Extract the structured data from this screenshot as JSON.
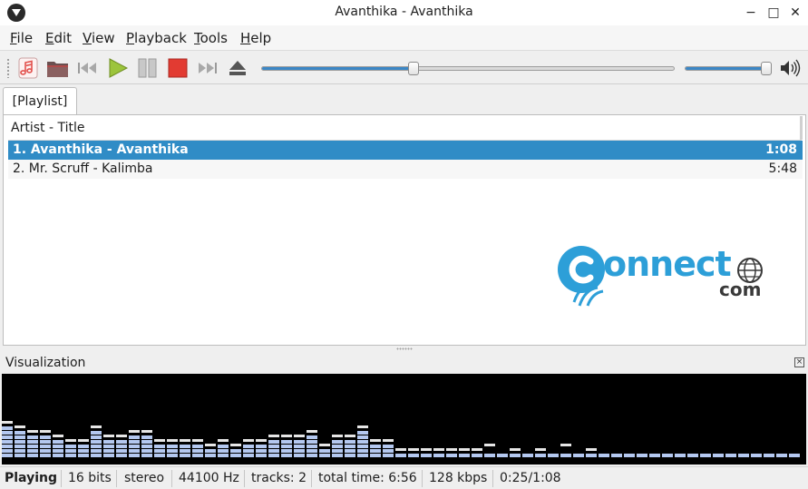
{
  "window": {
    "title": "Avanthika - Avanthika",
    "minimize_glyph": "−",
    "maximize_glyph": "□",
    "close_glyph": "✕"
  },
  "menu": [
    {
      "label": "File"
    },
    {
      "label": "Edit"
    },
    {
      "label": "View"
    },
    {
      "label": "Playback"
    },
    {
      "label": "Tools"
    },
    {
      "label": "Help"
    }
  ],
  "toolbar": {
    "buttons": [
      "add-files-icon",
      "open-folder-icon",
      "previous-icon",
      "play-icon",
      "pause-icon",
      "stop-icon",
      "next-icon",
      "eject-icon"
    ],
    "seek_fraction": 0.368,
    "volume_fraction": 0.95,
    "volume_icon": "speaker-icon"
  },
  "playlist": {
    "tab_label": "[Playlist]",
    "column_header": "Artist - Title",
    "rows": [
      {
        "title": "1. Avanthika - Avanthika",
        "duration": "1:08",
        "selected": true
      },
      {
        "title": "2. Mr. Scruff - Kalimba",
        "duration": "5:48",
        "selected": false
      }
    ]
  },
  "watermark": {
    "main": "onnect",
    "sub": "com"
  },
  "visualization": {
    "title": "Visualization",
    "close_glyph": "×",
    "bar_levels": [
      7,
      6,
      5,
      5,
      4,
      3,
      3,
      6,
      4,
      4,
      5,
      5,
      3,
      3,
      3,
      3,
      2,
      3,
      2,
      3,
      3,
      4,
      4,
      4,
      5,
      2,
      4,
      4,
      6,
      3,
      3,
      1,
      1,
      1,
      1,
      1,
      1,
      1,
      1,
      1,
      1,
      1,
      1,
      1,
      1,
      1,
      1,
      1,
      1,
      1,
      1,
      1,
      1,
      1,
      1,
      1,
      1,
      1,
      1,
      1,
      1,
      1,
      1
    ],
    "peak_levels": [
      8,
      7,
      6,
      6,
      5,
      4,
      4,
      7,
      5,
      5,
      6,
      6,
      4,
      4,
      4,
      4,
      3,
      4,
      3,
      4,
      4,
      5,
      5,
      5,
      6,
      3,
      5,
      5,
      7,
      4,
      4,
      2,
      2,
      2,
      2,
      2,
      2,
      2,
      3,
      1,
      2,
      1,
      2,
      1,
      3,
      1,
      2,
      1,
      1,
      1,
      1,
      1,
      1,
      1,
      1,
      1,
      1,
      1,
      1,
      1,
      1,
      1,
      1
    ],
    "bar_color": "#b4c8f0",
    "peak_color": "#e6e6e6"
  },
  "status": {
    "state": "Playing",
    "bits": "16 bits",
    "channels": "stereo",
    "sample_rate": "44100 Hz",
    "tracks": "tracks: 2",
    "total_time": "total time: 6:56",
    "bitrate": "128 kbps",
    "position": "0:25/1:08"
  }
}
